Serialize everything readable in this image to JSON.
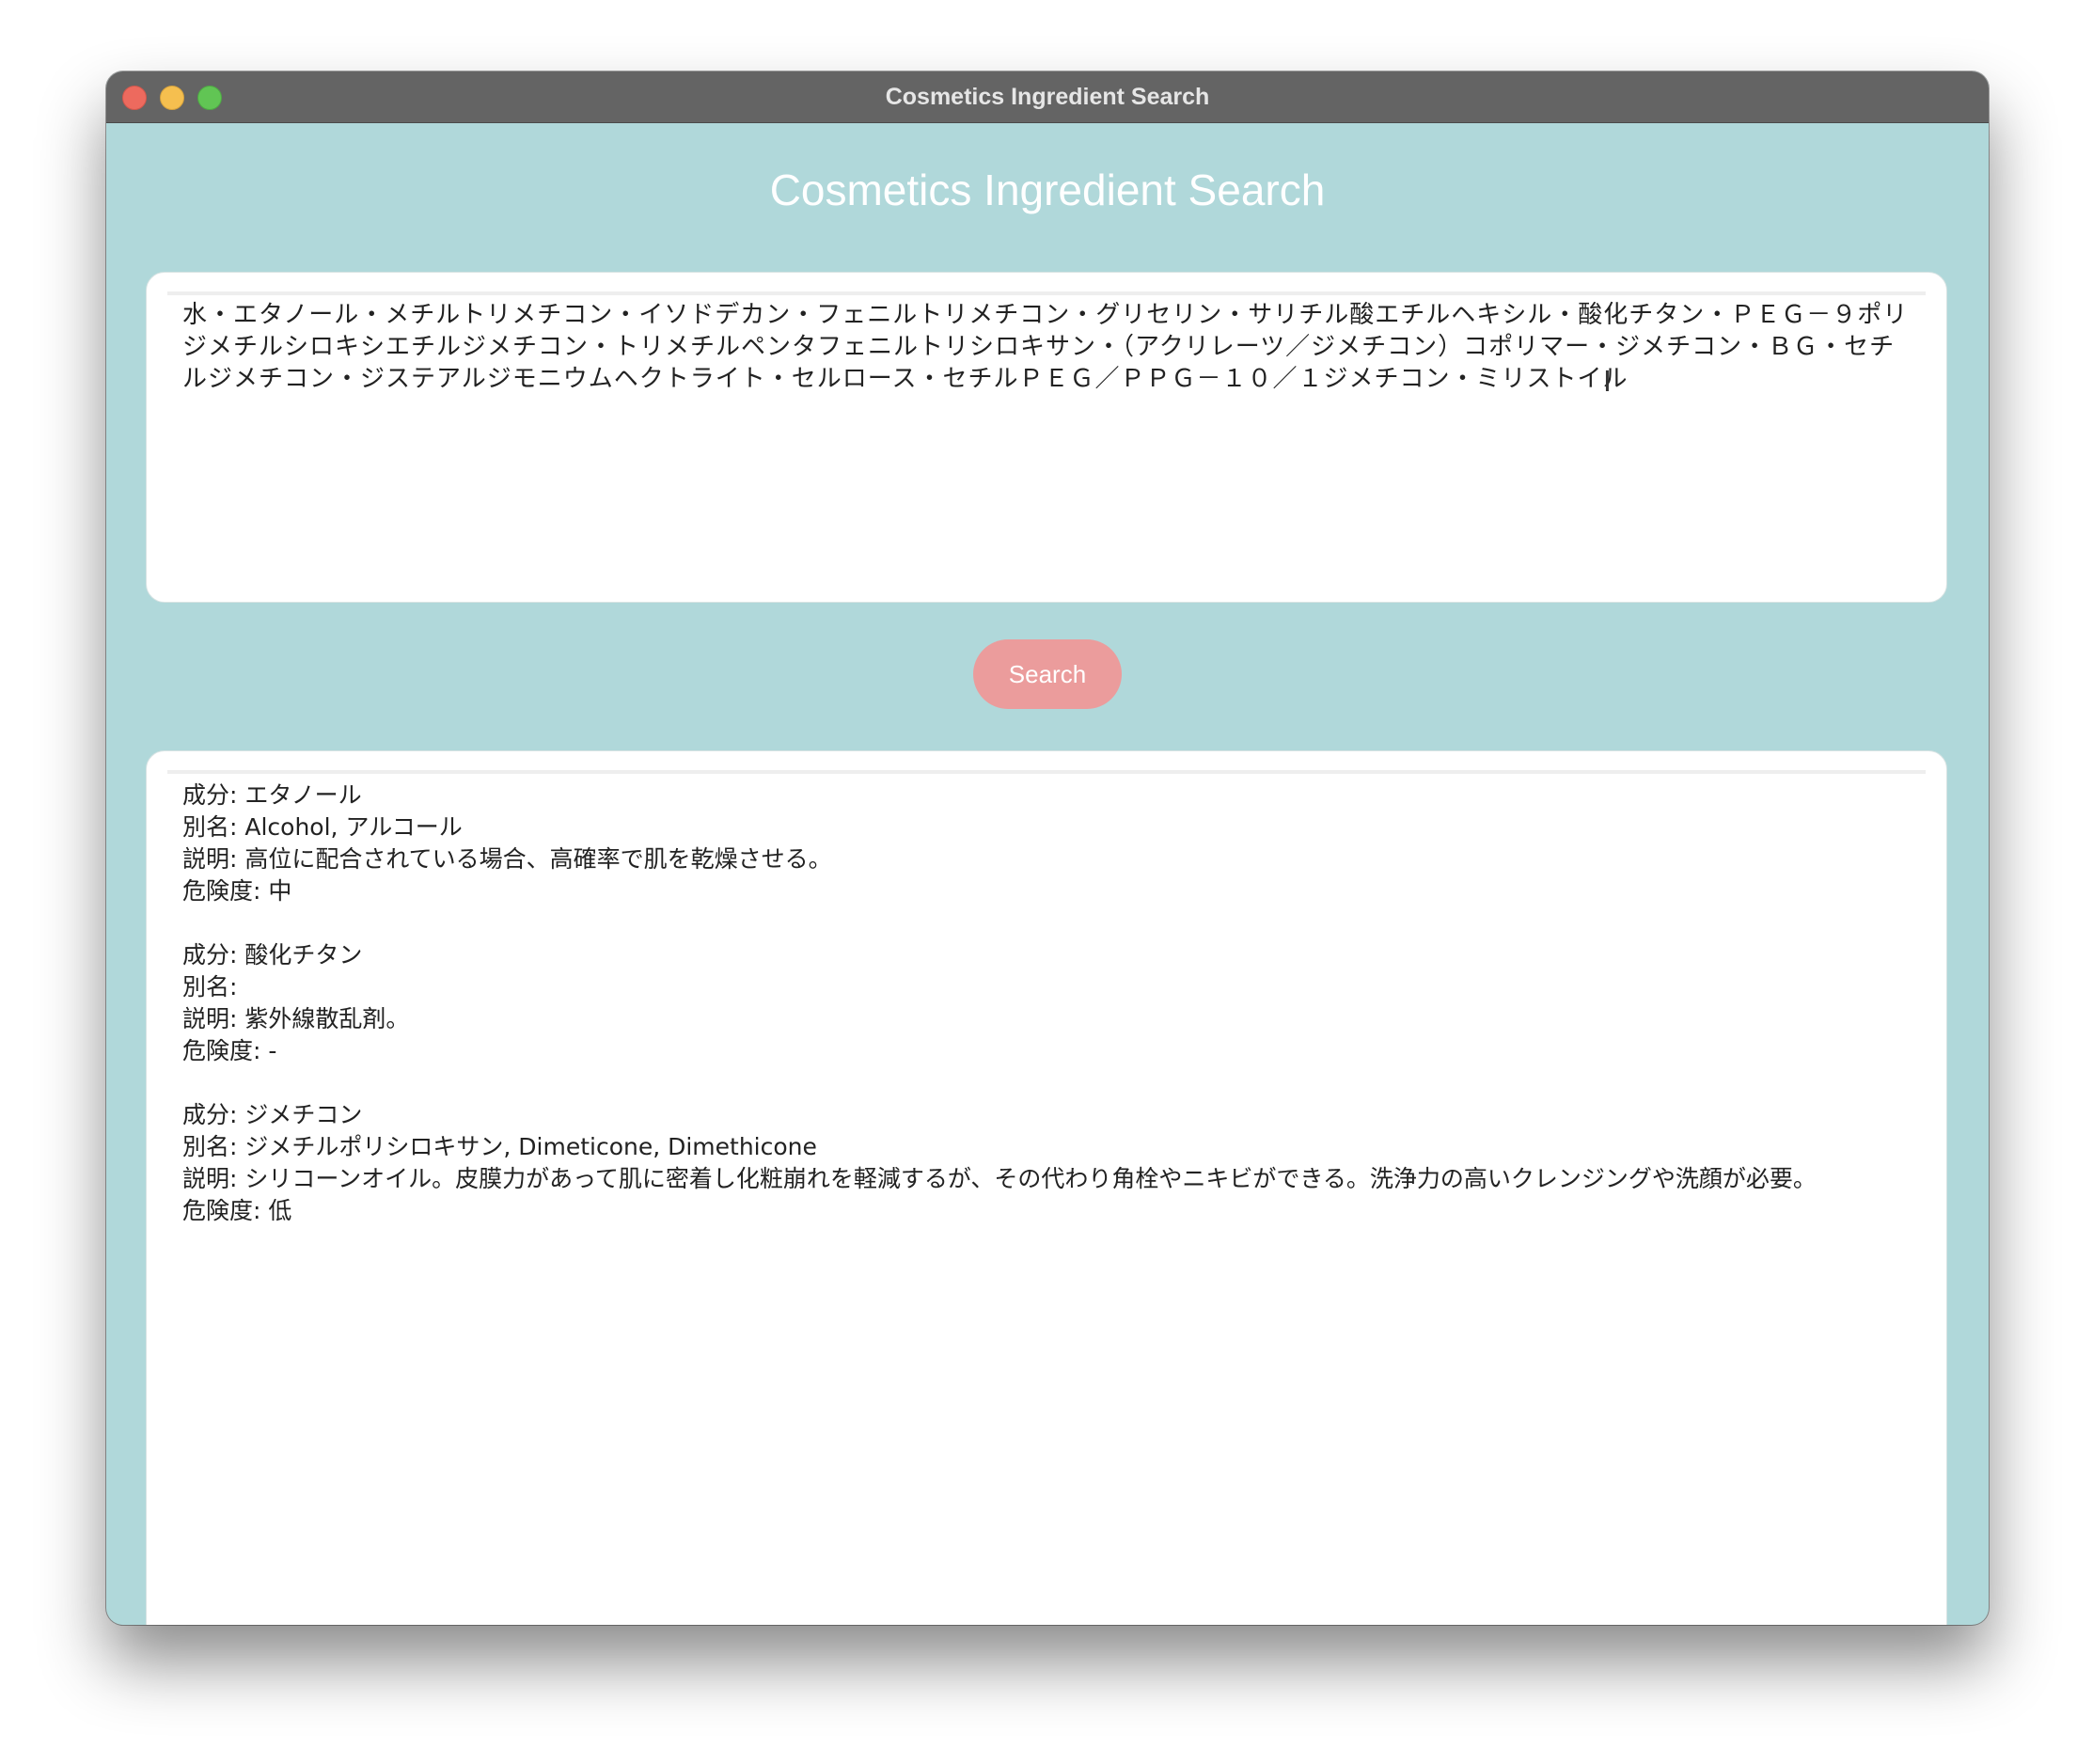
{
  "window": {
    "title": "Cosmetics Ingredient Search"
  },
  "app": {
    "heading": "Cosmetics Ingredient Search"
  },
  "input": {
    "value": "水・エタノール・メチルトリメチコン・イソドデカン・フェニルトリメチコン・グリセリン・サリチル酸エチルヘキシル・酸化チタン・ＰＥＧ－９ポリジメチルシロキシエチルジメチコン・トリメチルペンタフェニルトリシロキサン・（アクリレーツ／ジメチコン）コポリマー・ジメチコン・ＢＧ・セチルジメチコン・ジステアルジモニウムヘクトライト・セルロース・セチルＰＥＧ／ＰＰＧ－１０／１ジメチコン・ミリストイル"
  },
  "search_button": {
    "label": "Search"
  },
  "results": [
    {
      "ingredient": "成分: エタノール",
      "aliases": "別名: Alcohol, アルコール",
      "description": "説明: 高位に配合されている場合、高確率で肌を乾燥させる。",
      "risk": "危険度: 中"
    },
    {
      "ingredient": "成分: 酸化チタン",
      "aliases": "別名: ",
      "description": "説明: 紫外線散乱剤。",
      "risk": "危険度: -"
    },
    {
      "ingredient": "成分: ジメチコン",
      "aliases": "別名: ジメチルポリシロキサン, Dimeticone, Dimethicone",
      "description": "説明: シリコーンオイル。皮膜力があって肌に密着し化粧崩れを軽減するが、その代わり角栓やニキビができる。洗浄力の高いクレンジングや洗顔が必要。",
      "risk": "危険度: 低"
    }
  ],
  "colors": {
    "window_background": "#b0d8da",
    "titlebar": "#646464",
    "button": "#eb9c9c",
    "panel": "#ffffff"
  }
}
